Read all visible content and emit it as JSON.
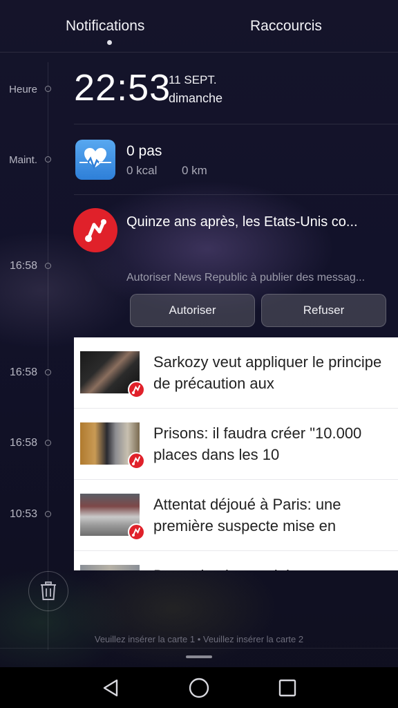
{
  "tabs": {
    "notifications": "Notifications",
    "shortcuts": "Raccourcis"
  },
  "timeline": {
    "heure": "Heure",
    "maint": "Maint.",
    "t1": "16:58",
    "t2": "16:58",
    "t3": "16:58",
    "t4": "10:53"
  },
  "clock": {
    "time": "22:53",
    "date": "11 SEPT.",
    "day": "dimanche"
  },
  "health": {
    "steps": "0 pas",
    "kcal": "0 kcal",
    "km": "0 km",
    "icon": "heart-pulse-icon"
  },
  "news_notification": {
    "title": "Quinze ans après, les Etats-Unis co...",
    "permission": "Autoriser News Republic à publier des messag...",
    "allow_label": "Autoriser",
    "refuse_label": "Refuser"
  },
  "news_items": [
    {
      "text": "Sarkozy veut appliquer le principe de précaution aux"
    },
    {
      "text": "Prisons: il faudra créer \"10.000 places dans les 10"
    },
    {
      "text": "Attentat déjoué à Paris: une première suspecte mise en"
    },
    {
      "text": "Dans ci ouly nas duh sas avent"
    }
  ],
  "sim_status": "Veuillez insérer la carte 1 • Veuillez insérer la carte 2",
  "colors": {
    "news_red": "#e0212a",
    "health_blue": "#3a8ee0"
  }
}
